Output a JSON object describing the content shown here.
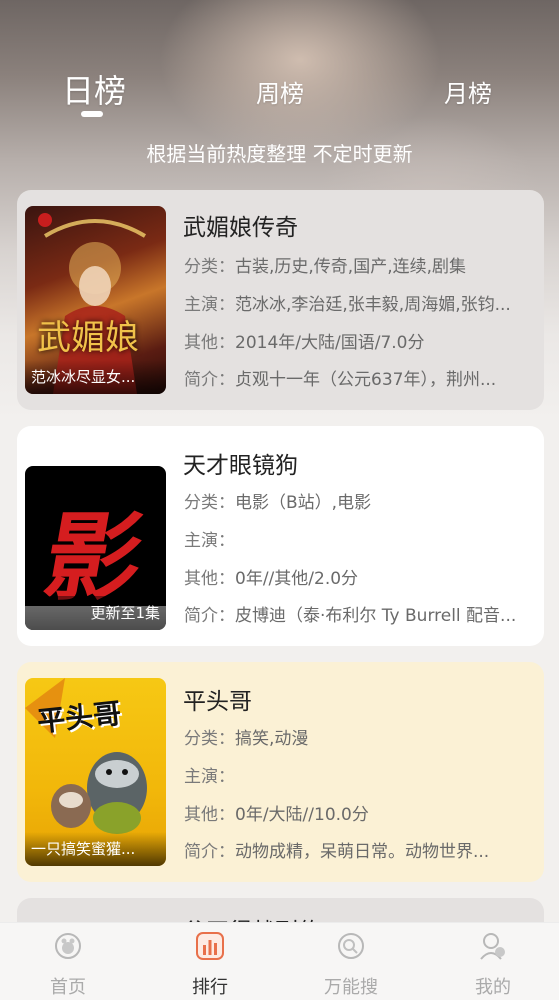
{
  "tabs": [
    {
      "label": "日榜",
      "active": true
    },
    {
      "label": "周榜",
      "active": false
    },
    {
      "label": "月榜",
      "active": false
    }
  ],
  "subtitle": "根据当前热度整理 不定时更新",
  "cards": [
    {
      "title": "武媚娘传奇",
      "poster_caption": "范冰冰尽显女...",
      "poster_text": "武媚娘",
      "rows": [
        {
          "label": "分类：",
          "value": "古装,历史,传奇,国产,连续,剧集"
        },
        {
          "label": "主演：",
          "value": "范冰冰,李治廷,张丰毅,周海媚,张钧..."
        },
        {
          "label": "其他：",
          "value": "2014年/大陆/国语/7.0分"
        },
        {
          "label": "简介：",
          "value": "贞观十一年（公元637年），荆州..."
        }
      ],
      "bg_color": "#e4e1e0"
    },
    {
      "title": "天才眼镜狗",
      "poster_caption": "更新至1集",
      "poster_text": "影",
      "rows": [
        {
          "label": "分类：",
          "value": "电影（B站）,电影"
        },
        {
          "label": "主演：",
          "value": ""
        },
        {
          "label": "其他：",
          "value": "0年//其他/2.0分"
        },
        {
          "label": "简介：",
          "value": "皮博迪（泰·布利尔 Ty Burrell 配音..."
        }
      ],
      "bg_color": "#ffffff"
    },
    {
      "title": "平头哥",
      "poster_caption": "一只搞笑蜜獾...",
      "poster_text": "平头哥",
      "rows": [
        {
          "label": "分类：",
          "value": "搞笑,动漫"
        },
        {
          "label": "主演：",
          "value": ""
        },
        {
          "label": "其他：",
          "value": "0年/大陆//10.0分"
        },
        {
          "label": "简介：",
          "value": "动物成精，呆萌日常。动物世界..."
        }
      ],
      "bg_color": "#fbf1d5"
    },
    {
      "title": "谷正得战列传",
      "bg_color": "#e4e1e0"
    }
  ],
  "bottom_nav": [
    {
      "label": "首页",
      "icon": "home-icon",
      "active": false
    },
    {
      "label": "排行",
      "icon": "ranking-icon",
      "active": true
    },
    {
      "label": "万能搜",
      "icon": "search-icon",
      "active": false
    },
    {
      "label": "我的",
      "icon": "profile-icon",
      "active": false
    }
  ],
  "colors": {
    "accent": "#e8704a",
    "nav_inactive": "#aaaaaa",
    "nav_active": "#333333"
  }
}
